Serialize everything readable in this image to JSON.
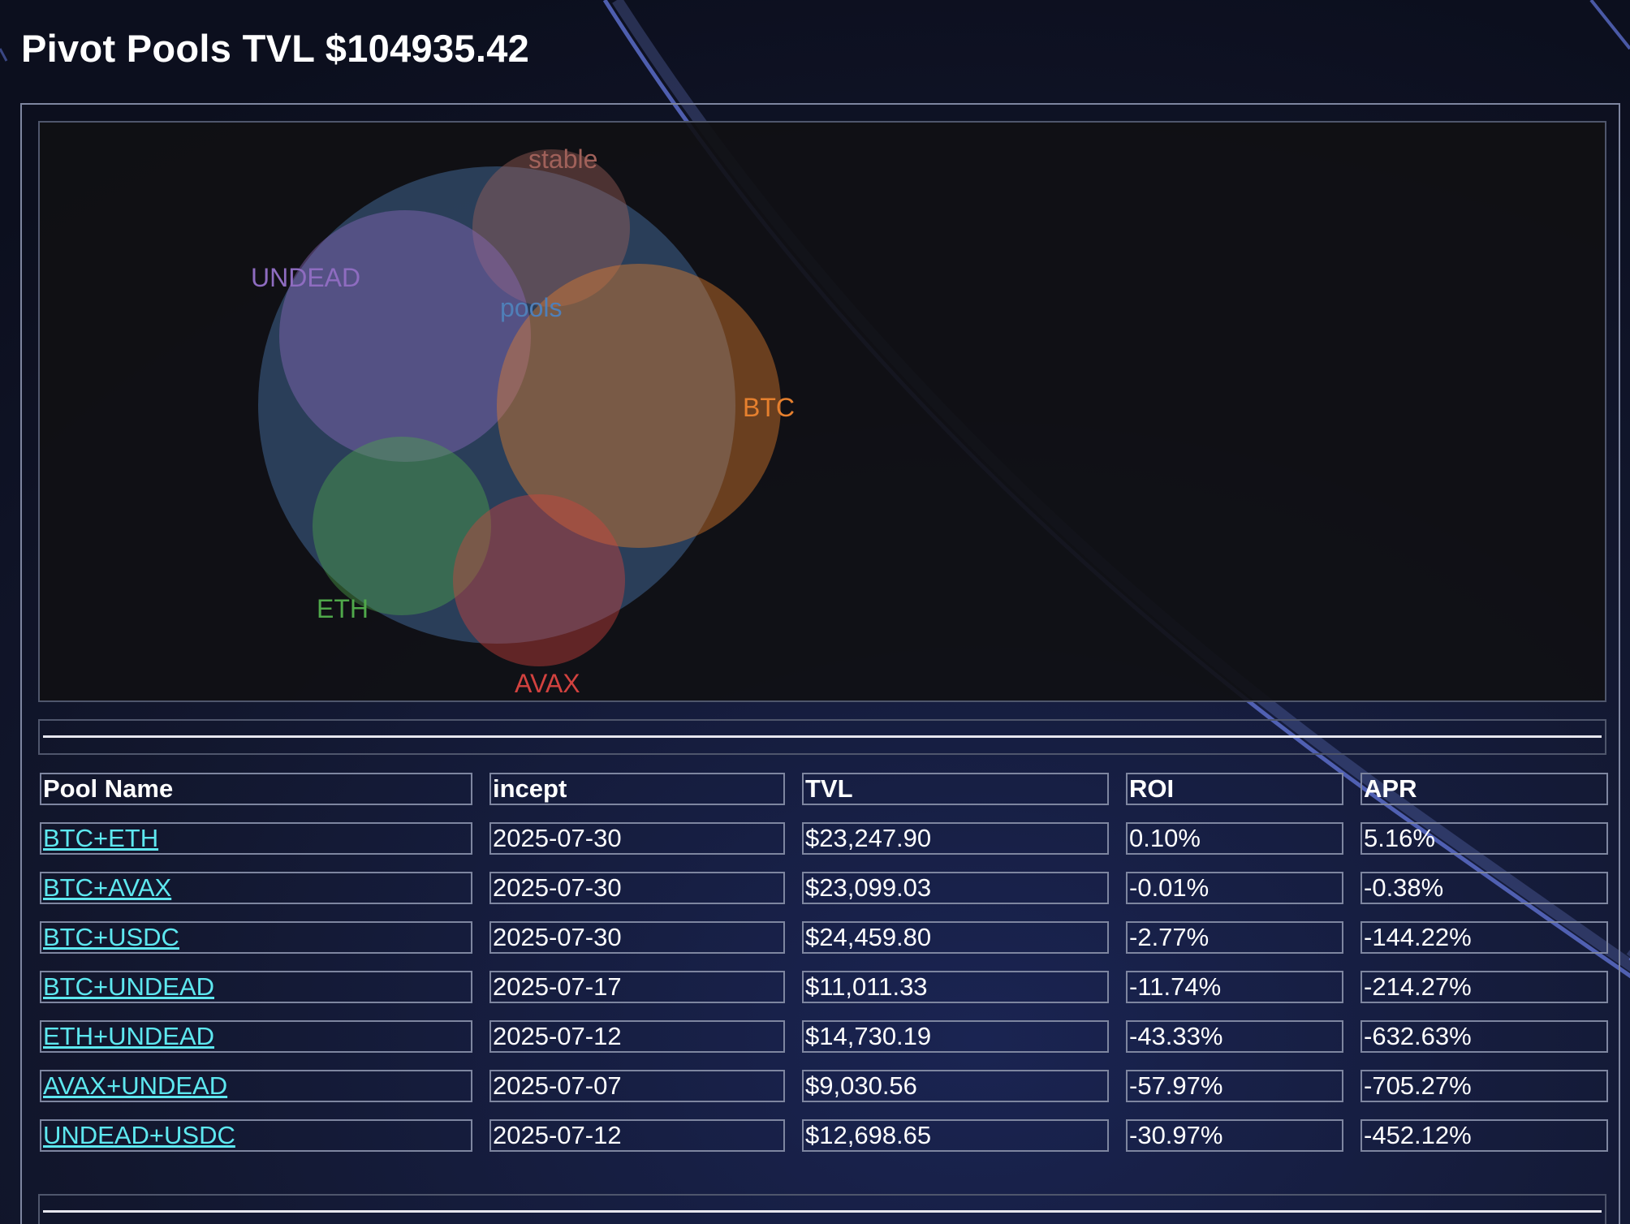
{
  "page": {
    "title": "Pivot Pools TVL $104935.42"
  },
  "bubble_chart": {
    "labels": {
      "pools": "pools",
      "stable": "stable",
      "undead": "UNDEAD",
      "btc": "BTC",
      "eth": "ETH",
      "avax": "AVAX"
    },
    "colors": {
      "pools": "#4f7fb8",
      "stable": "#a0615a",
      "undead": "#8e6cc0",
      "btc": "#e6802e",
      "eth": "#4fa84a",
      "avax": "#d2423f"
    }
  },
  "table": {
    "headers": [
      "Pool Name",
      "incept",
      "TVL",
      "ROI",
      "APR"
    ],
    "rows": [
      {
        "name": "BTC+ETH",
        "incept": "2025-07-30",
        "tvl": "$23,247.90",
        "roi": "0.10%",
        "apr": "5.16%"
      },
      {
        "name": "BTC+AVAX",
        "incept": "2025-07-30",
        "tvl": "$23,099.03",
        "roi": "-0.01%",
        "apr": "-0.38%"
      },
      {
        "name": "BTC+USDC",
        "incept": "2025-07-30",
        "tvl": "$24,459.80",
        "roi": "-2.77%",
        "apr": "-144.22%"
      },
      {
        "name": "BTC+UNDEAD",
        "incept": "2025-07-17",
        "tvl": "$11,011.33",
        "roi": "-11.74%",
        "apr": "-214.27%"
      },
      {
        "name": "ETH+UNDEAD",
        "incept": "2025-07-12",
        "tvl": "$14,730.19",
        "roi": "-43.33%",
        "apr": "-632.63%"
      },
      {
        "name": "AVAX+UNDEAD",
        "incept": "2025-07-07",
        "tvl": "$9,030.56",
        "roi": "-57.97%",
        "apr": "-705.27%"
      },
      {
        "name": "UNDEAD+USDC",
        "incept": "2025-07-12",
        "tvl": "$12,698.65",
        "roi": "-30.97%",
        "apr": "-452.12%"
      }
    ]
  },
  "theme": {
    "link_color": "#5ee8f0",
    "background": "#111529"
  }
}
